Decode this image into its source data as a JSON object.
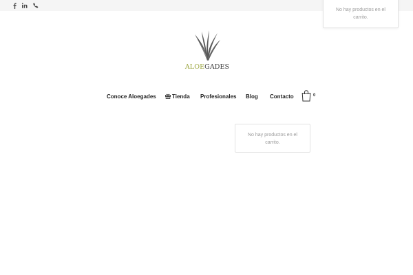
{
  "topbar": {
    "social": [
      {
        "icon": "facebook-icon"
      },
      {
        "icon": "linkedin-icon"
      },
      {
        "icon": "phone-icon"
      }
    ]
  },
  "header": {
    "logo": {
      "text_accent": "ALOE",
      "text_rest": "GADES",
      "accent_color": "#9aa43c"
    }
  },
  "nav": {
    "items": [
      {
        "label": "Conoce Aloegades"
      },
      {
        "label": "Tienda",
        "icon": "gift-icon"
      },
      {
        "label": "Profesionales"
      },
      {
        "label": "Blog"
      },
      {
        "label": "Contacto"
      }
    ],
    "cart": {
      "count": "0",
      "icon": "shopping-bag-icon"
    }
  },
  "cart_popup": {
    "empty_message": "No hay productos en el carrito."
  },
  "cart_dropdown": {
    "empty_message": "No hay productos en el carrito."
  }
}
